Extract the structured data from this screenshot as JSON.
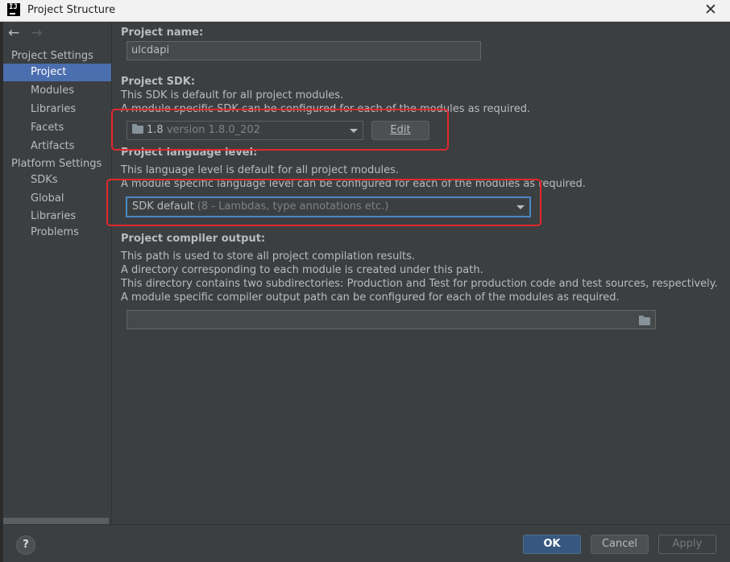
{
  "window": {
    "title": "Project Structure",
    "app_icon": "IJ",
    "close_glyph": "✕"
  },
  "nav": {
    "back": "←",
    "forward": "→"
  },
  "sidebar": {
    "section_project": "Project Settings",
    "project_items": [
      {
        "label": "Project",
        "selected": true
      },
      {
        "label": "Modules"
      },
      {
        "label": "Libraries"
      },
      {
        "label": "Facets"
      },
      {
        "label": "Artifacts"
      }
    ],
    "section_platform": "Platform Settings",
    "platform_items": [
      {
        "label": "SDKs"
      },
      {
        "label": "Global Libraries"
      }
    ],
    "problems": "Problems"
  },
  "main": {
    "name_label": "Project name:",
    "name_value": "ulcdapi",
    "sdk_label": "Project SDK:",
    "sdk_desc1": "This SDK is default for all project modules.",
    "sdk_desc2": "A module specific SDK can be configured for each of the modules as required.",
    "sdk_name": "1.8",
    "sdk_version": "version 1.8.0_202",
    "edit_button": "Edit",
    "lang_label": "Project language level:",
    "lang_desc1": "This language level is default for all project modules.",
    "lang_desc2": "A module specific language level can be configured for each of the modules as required.",
    "lang_value": "SDK default",
    "lang_detail": "(8 - Lambdas, type annotations etc.)",
    "output_label": "Project compiler output:",
    "output_desc1": "This path is used to store all project compilation results.",
    "output_desc2": "A directory corresponding to each module is created under this path.",
    "output_desc3": "This directory contains two subdirectories: Production and Test for production code and test sources, respectively.",
    "output_desc4": "A module specific compiler output path can be configured for each of the modules as required.",
    "output_value": ""
  },
  "footer": {
    "help": "?",
    "ok": "OK",
    "cancel": "Cancel",
    "apply": "Apply"
  },
  "colors": {
    "accent": "#4b6eaf",
    "highlight_box": "#e0282c",
    "background": "#3c3f41"
  },
  "icons": [
    "idea-app-icon",
    "close-icon",
    "back-arrow-icon",
    "forward-arrow-icon",
    "folder-icon",
    "chevron-down-icon",
    "help-icon"
  ]
}
